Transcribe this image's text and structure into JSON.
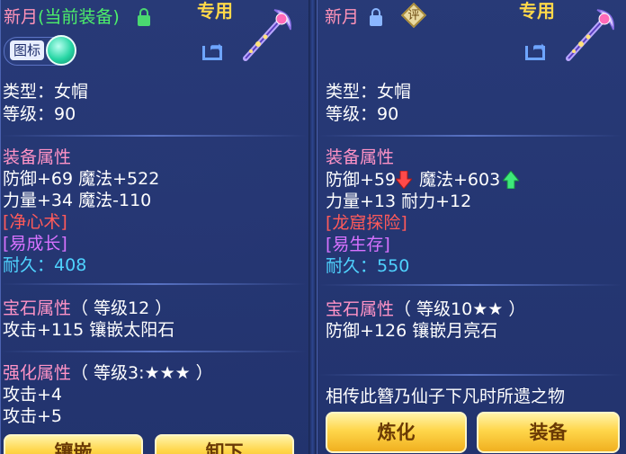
{
  "left": {
    "title_name": "新月",
    "title_status": "(当前装备)",
    "exclusive": "专用",
    "icon_toggle_label": "图标",
    "type_line": "类型：女帽",
    "level_line": "等级：90",
    "attr_header": "装备属性",
    "attr_line1": "防御+69 魔法+522",
    "attr_line2": "力量+34 魔法-110",
    "skill1": "[净心术]",
    "skill2": "[易成长]",
    "durability_label": "耐久：",
    "durability_value": "408",
    "gem_header": "宝石属性",
    "gem_level": "（ 等级12 ）",
    "gem_line": "攻击+115 镶嵌太阳石",
    "enhance_header": "强化属性",
    "enhance_level": "（ 等级3:★★★ ）",
    "enhance_line1": "攻击+4",
    "enhance_line2": "攻击+5",
    "btn_inlay": "镶嵌",
    "btn_remove": "卸下"
  },
  "right": {
    "title_name": "新月",
    "ping_label": "评",
    "exclusive": "专用",
    "type_line": "类型：女帽",
    "level_line": "等级：90",
    "attr_header": "装备属性",
    "attr_def": "防御+59",
    "attr_magic": "魔法+603",
    "attr_line2": "力量+13 耐力+12",
    "skill1": "[龙窟探险]",
    "skill2": "[易生存]",
    "durability_label": "耐久：",
    "durability_value": "550",
    "gem_header": "宝石属性",
    "gem_level": "（ 等级10★★ ）",
    "gem_line": "防御+126 镶嵌月亮石",
    "description": "相传此簪乃仙子下凡时所遗之物",
    "btn_refine": "炼化",
    "btn_equip": "装备"
  },
  "colors": {
    "panel": "#283a78",
    "gold_text": "#ffd84a",
    "pink_header": "#ff93c6",
    "skill_red": "#ff5a5a",
    "skill_purple": "#d772ff",
    "durability": "#4fd3ff",
    "button": "#ffd64a"
  },
  "icons": [
    "lock-icon",
    "share-icon",
    "hairpin-weapon-icon",
    "arrow-down-icon",
    "arrow-up-icon",
    "rating-badge-icon"
  ]
}
